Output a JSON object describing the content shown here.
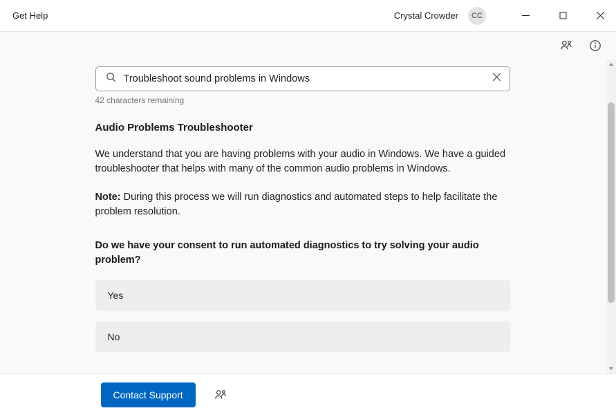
{
  "window": {
    "title": "Get Help",
    "user_name": "Crystal Crowder",
    "user_initials": "CC"
  },
  "search": {
    "value": "Troubleshoot sound problems in Windows",
    "char_remaining": "42 characters remaining"
  },
  "article": {
    "heading": "Audio Problems Troubleshooter",
    "intro": "We understand that you are having problems with your audio in Windows. We have a guided troubleshooter that helps with many of the common audio problems in Windows.",
    "note_label": "Note:",
    "note_text": " During this process we will run diagnostics and automated steps to help facilitate the problem resolution.",
    "question": "Do we have your consent to run automated diagnostics to try solving your audio problem?",
    "options": {
      "yes": "Yes",
      "no": "No"
    }
  },
  "footer": {
    "contact_label": "Contact Support"
  }
}
